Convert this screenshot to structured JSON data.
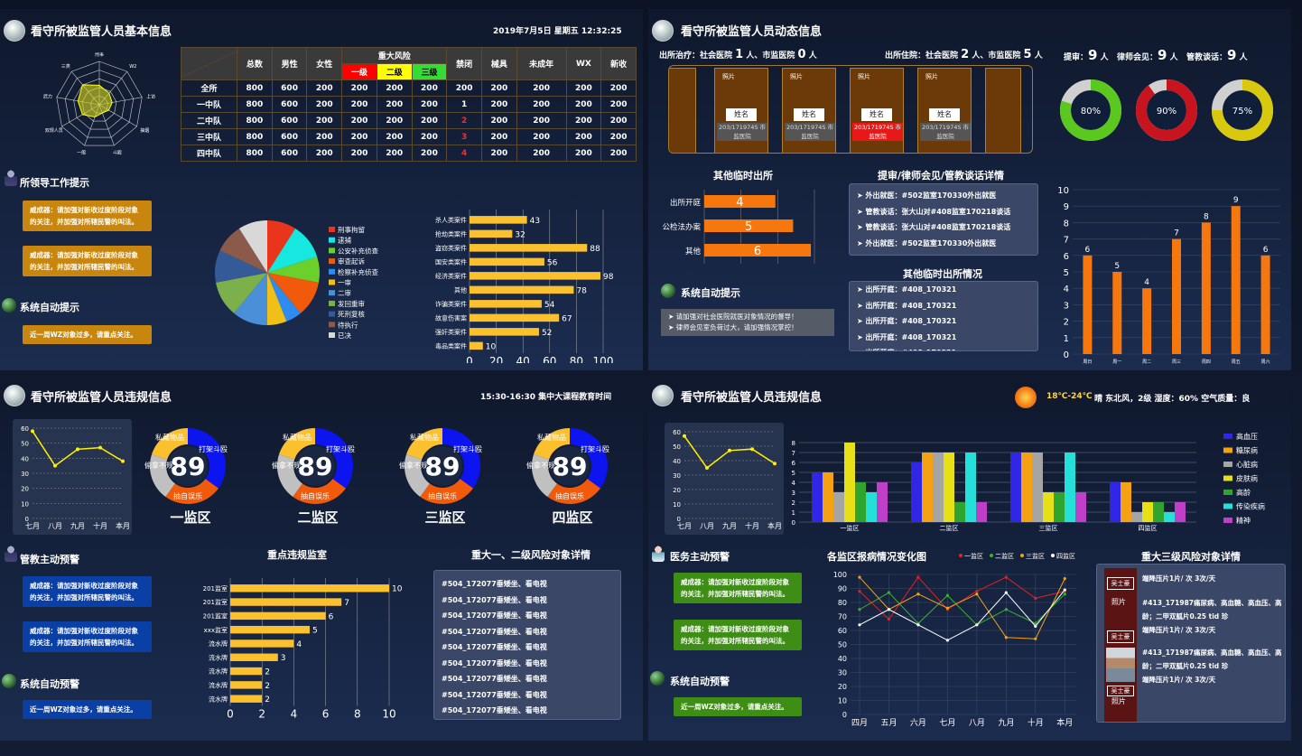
{
  "q1": {
    "title": "看守所被监管人员基本信息",
    "datetime": "2019年7月5日 星期五 12:32:25",
    "radar_labels": [
      "刑事",
      "W2",
      "上访",
      "抽烟",
      "斗殴",
      "一般",
      "双规人员",
      "武力",
      "三类"
    ],
    "table": {
      "headers": [
        "总数",
        "男性",
        "女性",
        "重大风险",
        "禁闭",
        "械具",
        "未成年",
        "WX",
        "新收"
      ],
      "risk_levels": [
        "一级",
        "二级",
        "三级"
      ],
      "rows": [
        [
          "全所",
          "800",
          "600",
          "200",
          "200",
          "200",
          "200",
          "200",
          "200",
          "200",
          "200",
          "200"
        ],
        [
          "一中队",
          "800",
          "600",
          "200",
          "200",
          "200",
          "200",
          "1",
          "200",
          "200",
          "200",
          "200"
        ],
        [
          "二中队",
          "800",
          "600",
          "200",
          "200",
          "200",
          "200",
          "2",
          "200",
          "200",
          "200",
          "200"
        ],
        [
          "三中队",
          "800",
          "600",
          "200",
          "200",
          "200",
          "200",
          "3",
          "200",
          "200",
          "200",
          "200"
        ],
        [
          "四中队",
          "800",
          "600",
          "200",
          "200",
          "200",
          "200",
          "4",
          "200",
          "200",
          "200",
          "200"
        ]
      ]
    },
    "leader_title": "所领导工作提示",
    "leader_tips": [
      "威成器：请加强对新收过度阶段对象的关注，并加强对所辖民警的叫法。",
      "威成器：请加强对新收过度阶段对象的关注，并加强对所辖民警的叫法。"
    ],
    "auto_title": "系统自动提示",
    "auto_tip": "近一周WZ对象过多，请重点关注。"
  },
  "q2": {
    "title": "看守所被监管人员动态信息",
    "out_treat": {
      "label": "出所治疗：",
      "a": "社会医院",
      "an": "1",
      "au": "人、",
      "b": "市监医院",
      "bn": "0",
      "bu": "人"
    },
    "out_live": {
      "label": "出所住院：",
      "a": "社会医院",
      "an": "2",
      "au": "人、",
      "b": "市监医院",
      "bn": "5",
      "bu": "人"
    },
    "stats": [
      {
        "label": "提审：",
        "num": "9",
        "unit": "人"
      },
      {
        "label": "律师会见：",
        "num": "9",
        "unit": "人"
      },
      {
        "label": "管教谈话：",
        "num": "9",
        "unit": "人"
      }
    ],
    "cards": [
      {
        "photo": "照片",
        "name": "姓名",
        "status": "203/171974S 市监医院"
      },
      {
        "photo": "照片",
        "name": "姓名",
        "status": "203/171974S 市监医院"
      },
      {
        "photo": "照片",
        "name": "姓名",
        "status": "203/171974S 市监医院"
      },
      {
        "photo": "照片",
        "name": "姓名",
        "status": "203/171974S 市监医院"
      },
      {
        "photo": "照片",
        "name": "姓名",
        "status": "203/171974S 市监医院"
      }
    ],
    "other_out_title": "其他临时出所",
    "interview_title": "提审/律师会见/管教谈话详情",
    "interview_list": [
      "外出就医：#502监室170330外出就医",
      "管教谈话：张大山对#408监室170218谈话",
      "管教谈话：张大山对#408监室170218谈话",
      "外出就医：#502监室170330外出就医"
    ],
    "other_out_detail_title": "其他临时出所情况",
    "other_out_list": [
      "出所开庭：#408_170321",
      "出所开庭：#408_170321",
      "出所开庭：#408_170321",
      "出所开庭：#408_170321",
      "出所开庭：#408_170321"
    ],
    "auto_title": "系统自动提示",
    "auto_list": [
      "请加强对社会医院就医对象情况的督导！",
      "律师会见室负荷过大，请加强情况掌控！"
    ]
  },
  "q3": {
    "title": "看守所被监管人员违规信息",
    "session": "15:30-16:30 集中大课程教育时间",
    "zones": [
      "一监区",
      "二监区",
      "三监区",
      "四监区"
    ],
    "donut_value": "89",
    "donut_labels": [
      "私藏物品",
      "打架斗殴",
      "偷拿不规",
      "抽自误乐"
    ],
    "warn_title": "管教主动预警",
    "warn_tips": [
      "威成器：请加强对新收过度阶段对象的关注，并加强对所辖民警的叫法。",
      "威成器：请加强对新收过度阶段对象的关注，并加强对所辖民警的叫法。"
    ],
    "auto_title": "系统自动预警",
    "auto_tip": "近一周WZ对象过多，请重点关注。",
    "key_title": "重点违规监室",
    "risk_title": "重大一、二级风险对象详情",
    "risk_list": [
      "#504_172077垂矮坐、看电视",
      "#504_172077垂矮坐、看电视",
      "#504_172077垂矮坐、看电视",
      "#504_172077垂矮坐、看电视",
      "#504_172077垂矮坐、看电视",
      "#504_172077垂矮坐、看电视",
      "#504_172077垂矮坐、看电视",
      "#504_172077垂矮坐、看电视",
      "#504_172077垂矮坐、看电视"
    ]
  },
  "q4": {
    "title": "看守所被监管人员违规信息",
    "weather": "18℃-24℃",
    "weather_text": "晴  东北风，2级  湿度：60%  空气质量：良",
    "med_title": "医务主动预警",
    "med_tips": [
      "威成器：请加强对新收过度阶段对象的关注，并加强对所辖民警的叫法。",
      "威成器：请加强对新收过度阶段对象的关注，并加强对所辖民警的叫法。"
    ],
    "auto_title": "系统自动预警",
    "auto_tip": "近一周WZ对象过多，请重点关注。",
    "change_title": "各监区报病情况变化图",
    "high_title": "重大三级风险对象详情",
    "high_entries": [
      {
        "name": "吴士豪",
        "photo": "照片",
        "lines": [
          "端降压片1片/ 次 3次/天"
        ]
      },
      {
        "name": "吴士豪",
        "photo": "",
        "lines": [
          "#413_171987痛尿病、高血糖、高血压、高 龄；二甲双胍片0.25 tid 珍",
          "端降压片1片/ 次 3次/天"
        ]
      },
      {
        "name": "吴士豪",
        "photo": "照片",
        "lines": [
          "#413_171987痛尿病、高血糖、高血压、高 龄；二甲双胍片0.25 tid 珍",
          "端降压片1片/ 次 3次/天"
        ]
      }
    ]
  },
  "colors": {
    "orange": "#f7770f",
    "yellow": "#fbc02d",
    "line_yellow": "#ffef00",
    "red": "#e81818",
    "green": "#38d838",
    "blue": "#0c3fd0"
  },
  "chart_data": [
    {
      "id": "radar",
      "type": "radar",
      "categories": [
        "刑事",
        "W2",
        "上访",
        "抽烟",
        "斗殴",
        "一般",
        "双规人员",
        "武力",
        "三类"
      ],
      "values": [
        0.45,
        0.35,
        0.3,
        0.25,
        0.2,
        0.3,
        0.45,
        0.5,
        0.6
      ]
    },
    {
      "id": "pie",
      "type": "pie",
      "series": [
        {
          "name": "刑事拘留",
          "value": 9,
          "color": "#e8351c"
        },
        {
          "name": "逮捕",
          "value": 11,
          "color": "#16e8e0"
        },
        {
          "name": "公安补充侦查",
          "value": 8,
          "color": "#6cd02c"
        },
        {
          "name": "审查起诉",
          "value": 11,
          "color": "#f05a0a"
        },
        {
          "name": "检察补充侦查",
          "value": 5,
          "color": "#2e8cf0"
        },
        {
          "name": "一审",
          "value": 6,
          "color": "#f0c018"
        },
        {
          "name": "二审",
          "value": 11,
          "color": "#4a90d8"
        },
        {
          "name": "发回重审",
          "value": 11,
          "color": "#7cb04a"
        },
        {
          "name": "死刑复核",
          "value": 10,
          "color": "#345a98"
        },
        {
          "name": "待执行",
          "value": 9,
          "color": "#8a5a4a"
        },
        {
          "name": "已决",
          "value": 9,
          "color": "#d8d8d8"
        }
      ]
    },
    {
      "id": "cases",
      "type": "bar",
      "categories": [
        "杀人类案件",
        "抢劫类案件",
        "盗窃类案件",
        "国安类案件",
        "经济类案件",
        "其他",
        "诈骗类案件",
        "故意伤害案",
        "强奸类案件",
        "毒品类案件"
      ],
      "values": [
        43,
        32,
        88,
        56,
        98,
        78,
        54,
        67,
        52,
        10
      ],
      "xlim": [
        0,
        100
      ],
      "xticks": [
        0,
        20,
        40,
        60,
        80,
        100
      ]
    },
    {
      "id": "otherout",
      "type": "bar",
      "categories": [
        "出所开庭",
        "公检法办案",
        "其他"
      ],
      "values": [
        4,
        5,
        6
      ]
    },
    {
      "id": "donuts",
      "type": "pie",
      "values": [
        80,
        90,
        75
      ],
      "colors": [
        "#5ac81e",
        "#c8141e",
        "#d8c80e"
      ]
    },
    {
      "id": "weekly",
      "type": "bar",
      "categories": [
        "周日",
        "周一",
        "周二",
        "周三",
        "周四",
        "周五",
        "周六"
      ],
      "values": [
        6,
        5,
        4,
        7,
        8,
        9,
        6
      ],
      "ylim": [
        0,
        10
      ]
    },
    {
      "id": "months1",
      "type": "line",
      "categories": [
        "七月",
        "八月",
        "九月",
        "十月",
        "本月"
      ],
      "values": [
        58,
        35,
        46,
        47,
        38
      ],
      "ylim": [
        0,
        60
      ]
    },
    {
      "id": "months2",
      "type": "line",
      "categories": [
        "七月",
        "八月",
        "九月",
        "十月",
        "本月"
      ],
      "values": [
        57,
        35,
        47,
        48,
        38
      ],
      "ylim": [
        0,
        60
      ]
    },
    {
      "id": "keyroom",
      "type": "bar",
      "categories": [
        "201监室",
        "201监室",
        "201监室",
        "xxx监室",
        "流水牌",
        "流水牌",
        "流水牌",
        "流水牌",
        "流水牌"
      ],
      "values": [
        10,
        7,
        6,
        5,
        4,
        3,
        2,
        2,
        2
      ],
      "xticks": [
        0,
        2,
        4,
        6,
        8,
        10
      ]
    },
    {
      "id": "disease",
      "type": "bar",
      "categories": [
        "一监区",
        "二监区",
        "三监区",
        "四监区"
      ],
      "series": [
        {
          "name": "高血压",
          "values": [
            5,
            6,
            7,
            4
          ],
          "color": "#2f26e6"
        },
        {
          "name": "糖尿病",
          "values": [
            5,
            7,
            7,
            4
          ],
          "color": "#f5a114"
        },
        {
          "name": "心脏病",
          "values": [
            3,
            7,
            7,
            1
          ],
          "color": "#a5a5a5"
        },
        {
          "name": "皮肤病",
          "values": [
            8,
            7,
            3,
            2
          ],
          "color": "#e8e017"
        },
        {
          "name": "高龄",
          "values": [
            4,
            2,
            3,
            2
          ],
          "color": "#2fa42e"
        },
        {
          "name": "传染疾病",
          "values": [
            3,
            7,
            7,
            1
          ],
          "color": "#25e0d8"
        },
        {
          "name": "精神",
          "values": [
            4,
            2,
            3,
            2
          ],
          "color": "#c03fc8"
        }
      ],
      "ylim": [
        0,
        8
      ]
    },
    {
      "id": "trend",
      "type": "line",
      "categories": [
        "四月",
        "五月",
        "六月",
        "七月",
        "八月",
        "九月",
        "十月",
        "本月"
      ],
      "series": [
        {
          "name": "一监区",
          "values": [
            88,
            68,
            98,
            75,
            88,
            98,
            83,
            88
          ],
          "color": "#e8201e"
        },
        {
          "name": "二监区",
          "values": [
            75,
            87,
            65,
            85,
            64,
            75,
            65,
            86
          ],
          "color": "#3fb02e"
        },
        {
          "name": "三监区",
          "values": [
            98,
            75,
            86,
            76,
            86,
            55,
            54,
            97
          ],
          "color": "#f5a114"
        },
        {
          "name": "四监区",
          "values": [
            64,
            75,
            64,
            53,
            64,
            87,
            63,
            89
          ],
          "color": "#ffffff"
        }
      ],
      "ylim": [
        0,
        100
      ]
    }
  ]
}
